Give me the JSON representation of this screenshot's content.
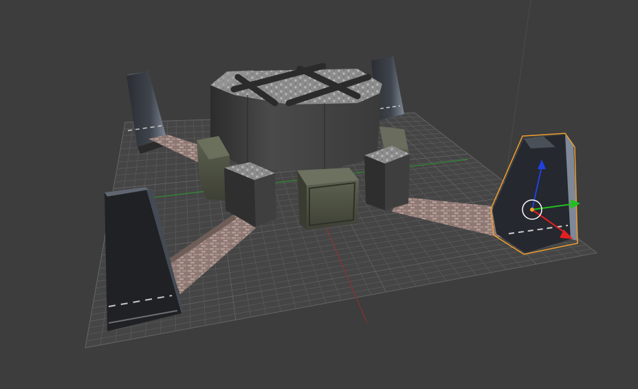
{
  "viewport": {
    "shading": "textured",
    "active_object": "watchtower",
    "colors": {
      "background": "#3d3d3d",
      "grid": "#5a5a5a",
      "grid_major": "#6a6a6a",
      "axis_x": "#8a3030",
      "axis_y": "#2f8a2f",
      "selection_outline": "#f0a030",
      "gizmo_x": "#e02020",
      "gizmo_y": "#20c020",
      "gizmo_z": "#2040e0",
      "pivot": "#f0a030"
    }
  },
  "scene_objects": [
    {
      "name": "central-tower",
      "icon": "octagonal-tower"
    },
    {
      "name": "pylon-back-left"
    },
    {
      "name": "pylon-back-right"
    },
    {
      "name": "pylon-front-left"
    },
    {
      "name": "pylon-right-selected",
      "selected": true
    },
    {
      "name": "crate"
    },
    {
      "name": "walkway"
    }
  ]
}
